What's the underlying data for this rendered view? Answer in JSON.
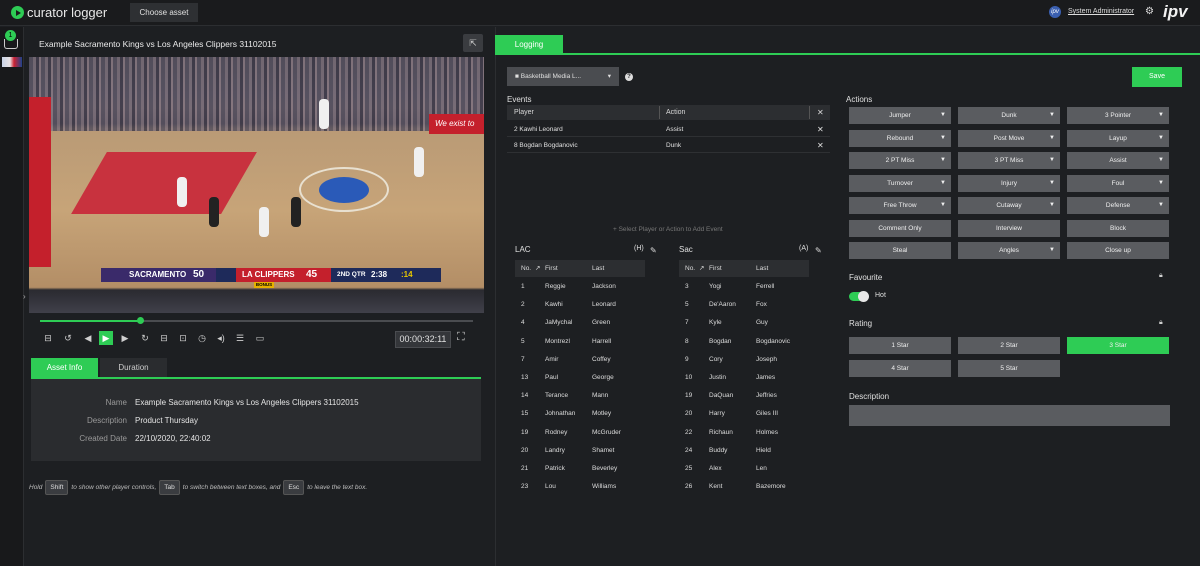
{
  "topbar": {
    "app_name": "curator logger",
    "choose_asset": "Choose asset",
    "user_initials": "ipv",
    "user_name": "System Administrator",
    "brand": "ipv"
  },
  "cart": {
    "count": "1"
  },
  "video": {
    "title": "Example Sacramento Kings vs Los Angeles Clippers 31102015",
    "banner_text": "We exist to",
    "scorebug": {
      "home_team": "SACRAMENTO",
      "home_score": "50",
      "away_team": "LA CLIPPERS",
      "away_score": "45",
      "period": "2ND QTR",
      "clock": "2:38",
      "shot_clock": ":14",
      "bonus": "BONUS"
    },
    "playback_progress": 0.23,
    "timecode": "00:00:32:11"
  },
  "asset_tabs": [
    "Asset Info",
    "Duration"
  ],
  "asset_info": {
    "name_label": "Name",
    "name_value": "Example Sacramento Kings vs Los Angeles Clippers 31102015",
    "description_label": "Description",
    "description_value": "Product Thursday",
    "created_label": "Created Date",
    "created_value": "22/10/2020, 22:40:02"
  },
  "hint": {
    "hold": "Hold",
    "shift": "Shift",
    "p1": "to show other player controls,",
    "tab": "Tab",
    "p2": "to switch between text boxes, and",
    "esc": "Esc",
    "p3": "to leave the text box."
  },
  "logging": {
    "tab": "Logging",
    "media_dropdown": "Basketball Media L...",
    "help": "?",
    "save": "Save"
  },
  "events": {
    "title": "Events",
    "col_player": "Player",
    "col_action": "Action",
    "rows": [
      {
        "player": "2 Kawhi Leonard",
        "action": "Assist"
      },
      {
        "player": "8 Bogdan Bogdanovic",
        "action": "Dunk"
      }
    ],
    "add_hint": "+ Select Player or Action to Add Event"
  },
  "teams": {
    "home": {
      "name": "LAC",
      "tag": "(H)",
      "col_no": "No.",
      "col_first": "First",
      "col_last": "Last",
      "players": [
        {
          "no": "1",
          "first": "Reggie",
          "last": "Jackson"
        },
        {
          "no": "2",
          "first": "Kawhi",
          "last": "Leonard"
        },
        {
          "no": "4",
          "first": "JaMychal",
          "last": "Green"
        },
        {
          "no": "5",
          "first": "Montrezl",
          "last": "Harrell"
        },
        {
          "no": "7",
          "first": "Amir",
          "last": "Coffey"
        },
        {
          "no": "13",
          "first": "Paul",
          "last": "George"
        },
        {
          "no": "14",
          "first": "Terance",
          "last": "Mann"
        },
        {
          "no": "15",
          "first": "Johnathan",
          "last": "Motley"
        },
        {
          "no": "19",
          "first": "Rodney",
          "last": "McGruder"
        },
        {
          "no": "20",
          "first": "Landry",
          "last": "Shamet"
        },
        {
          "no": "21",
          "first": "Patrick",
          "last": "Beverley"
        },
        {
          "no": "23",
          "first": "Lou",
          "last": "Williams"
        }
      ]
    },
    "away": {
      "name": "Sac",
      "tag": "(A)",
      "col_no": "No.",
      "col_first": "First",
      "col_last": "Last",
      "players": [
        {
          "no": "3",
          "first": "Yogi",
          "last": "Ferrell"
        },
        {
          "no": "5",
          "first": "De'Aaron",
          "last": "Fox"
        },
        {
          "no": "7",
          "first": "Kyle",
          "last": "Guy"
        },
        {
          "no": "8",
          "first": "Bogdan",
          "last": "Bogdanovic"
        },
        {
          "no": "9",
          "first": "Cory",
          "last": "Joseph"
        },
        {
          "no": "10",
          "first": "Justin",
          "last": "James"
        },
        {
          "no": "19",
          "first": "DaQuan",
          "last": "Jeffries"
        },
        {
          "no": "20",
          "first": "Harry",
          "last": "Giles III"
        },
        {
          "no": "22",
          "first": "Richaun",
          "last": "Holmes"
        },
        {
          "no": "24",
          "first": "Buddy",
          "last": "Hield"
        },
        {
          "no": "25",
          "first": "Alex",
          "last": "Len"
        },
        {
          "no": "26",
          "first": "Kent",
          "last": "Bazemore"
        }
      ]
    }
  },
  "actions": {
    "title": "Actions",
    "buttons": [
      {
        "label": "Jumper",
        "dropdown": true
      },
      {
        "label": "Dunk",
        "dropdown": true
      },
      {
        "label": "3 Pointer",
        "dropdown": true
      },
      {
        "label": "Rebound",
        "dropdown": true
      },
      {
        "label": "Post Move",
        "dropdown": true
      },
      {
        "label": "Layup",
        "dropdown": true
      },
      {
        "label": "2 PT Miss",
        "dropdown": true
      },
      {
        "label": "3 PT Miss",
        "dropdown": true
      },
      {
        "label": "Assist",
        "dropdown": true
      },
      {
        "label": "Turnover",
        "dropdown": true
      },
      {
        "label": "Injury",
        "dropdown": true
      },
      {
        "label": "Foul",
        "dropdown": true
      },
      {
        "label": "Free Throw",
        "dropdown": true
      },
      {
        "label": "Cutaway",
        "dropdown": true
      },
      {
        "label": "Defense",
        "dropdown": true
      },
      {
        "label": "Comment Only",
        "dropdown": false
      },
      {
        "label": "Interview",
        "dropdown": false
      },
      {
        "label": "Block",
        "dropdown": false
      },
      {
        "label": "Steal",
        "dropdown": false
      },
      {
        "label": "Angles",
        "dropdown": true
      },
      {
        "label": "Close up",
        "dropdown": false
      }
    ]
  },
  "favourite": {
    "title": "Favourite",
    "toggle_label": "Hot",
    "on": true
  },
  "rating": {
    "title": "Rating",
    "options": [
      "1 Star",
      "2 Star",
      "3 Star",
      "4 Star",
      "5 Star"
    ],
    "selected": "3 Star"
  },
  "description": {
    "title": "Description",
    "value": ""
  },
  "colors": {
    "accent": "#2ecc55",
    "button": "#5a5c60",
    "background": "#1d1f22"
  }
}
